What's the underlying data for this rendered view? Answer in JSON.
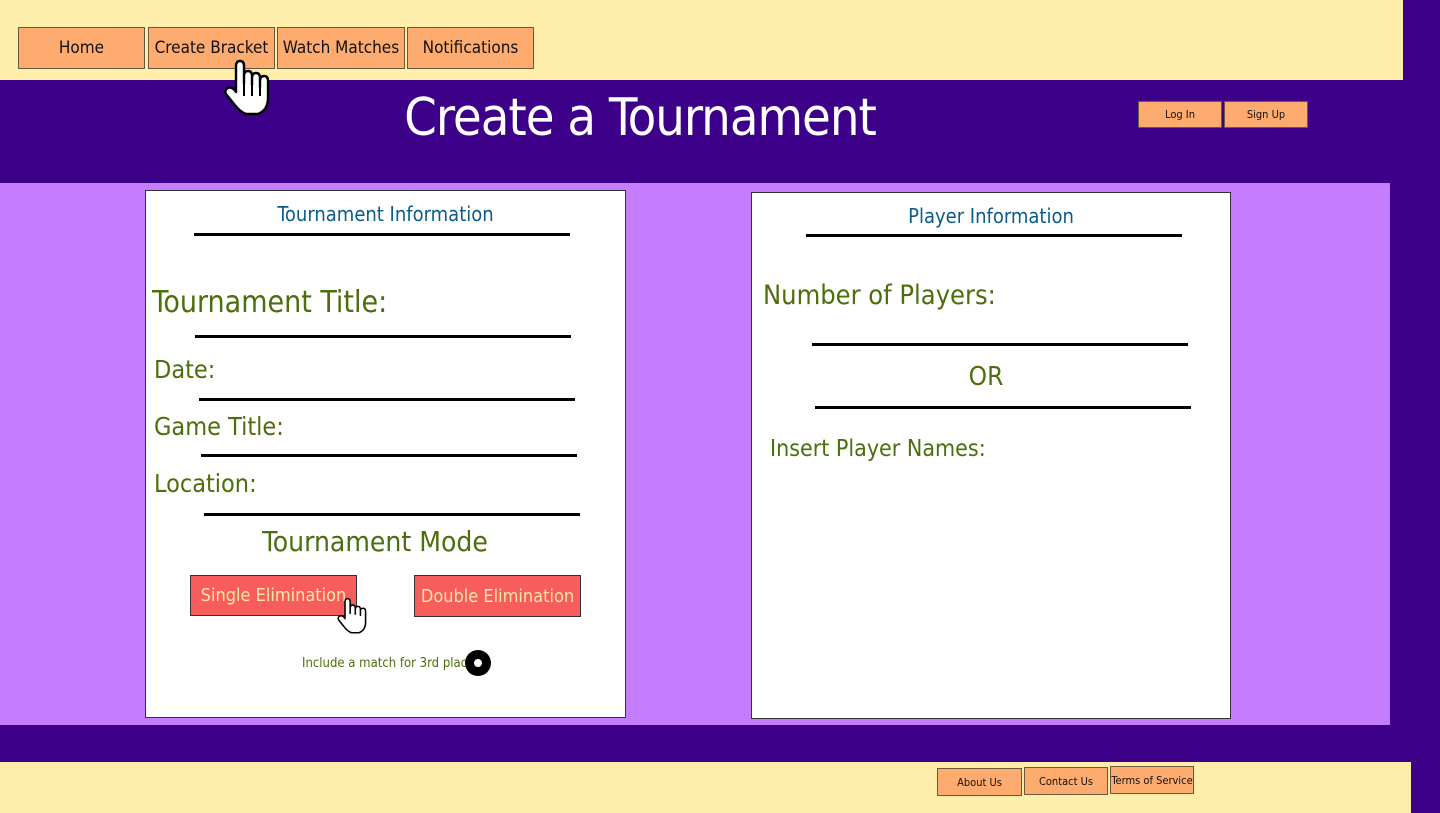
{
  "nav": {
    "items": [
      {
        "label": "Home"
      },
      {
        "label": "Create Bracket"
      },
      {
        "label": "Watch Matches"
      },
      {
        "label": "Notifications"
      }
    ]
  },
  "header": {
    "title": "Create a Tournament",
    "login_label": "Log In",
    "signup_label": "Sign Up"
  },
  "tournament_panel": {
    "heading": "Tournament Information",
    "title_label": "Tournament Title:",
    "date_label": "Date:",
    "game_label": "Game Title:",
    "location_label": "Location:",
    "mode_heading": "Tournament Mode",
    "single_label": "Single Elimination",
    "double_label": "Double Elimination",
    "third_place_label": "Include a match for 3rd place?"
  },
  "player_panel": {
    "heading": "Player Information",
    "count_label": "Number of Players:",
    "or_label": "OR",
    "names_label": "Insert Player Names:"
  },
  "footer": {
    "about_label": "About Us",
    "contact_label": "Contact Us",
    "terms_label": "Terms of Service"
  },
  "colors": {
    "page_bg": "#3d0088",
    "band_bg": "#c57cfd",
    "bar_bg": "#feeeac",
    "button_bg": "#fdab6e",
    "label_green": "#4d6e0c",
    "heading_blue": "#0d5b8b",
    "mode_button": "#f85d5d"
  },
  "icons": [
    "hand-pointer-cursor-icon",
    "radio-selected-icon"
  ]
}
